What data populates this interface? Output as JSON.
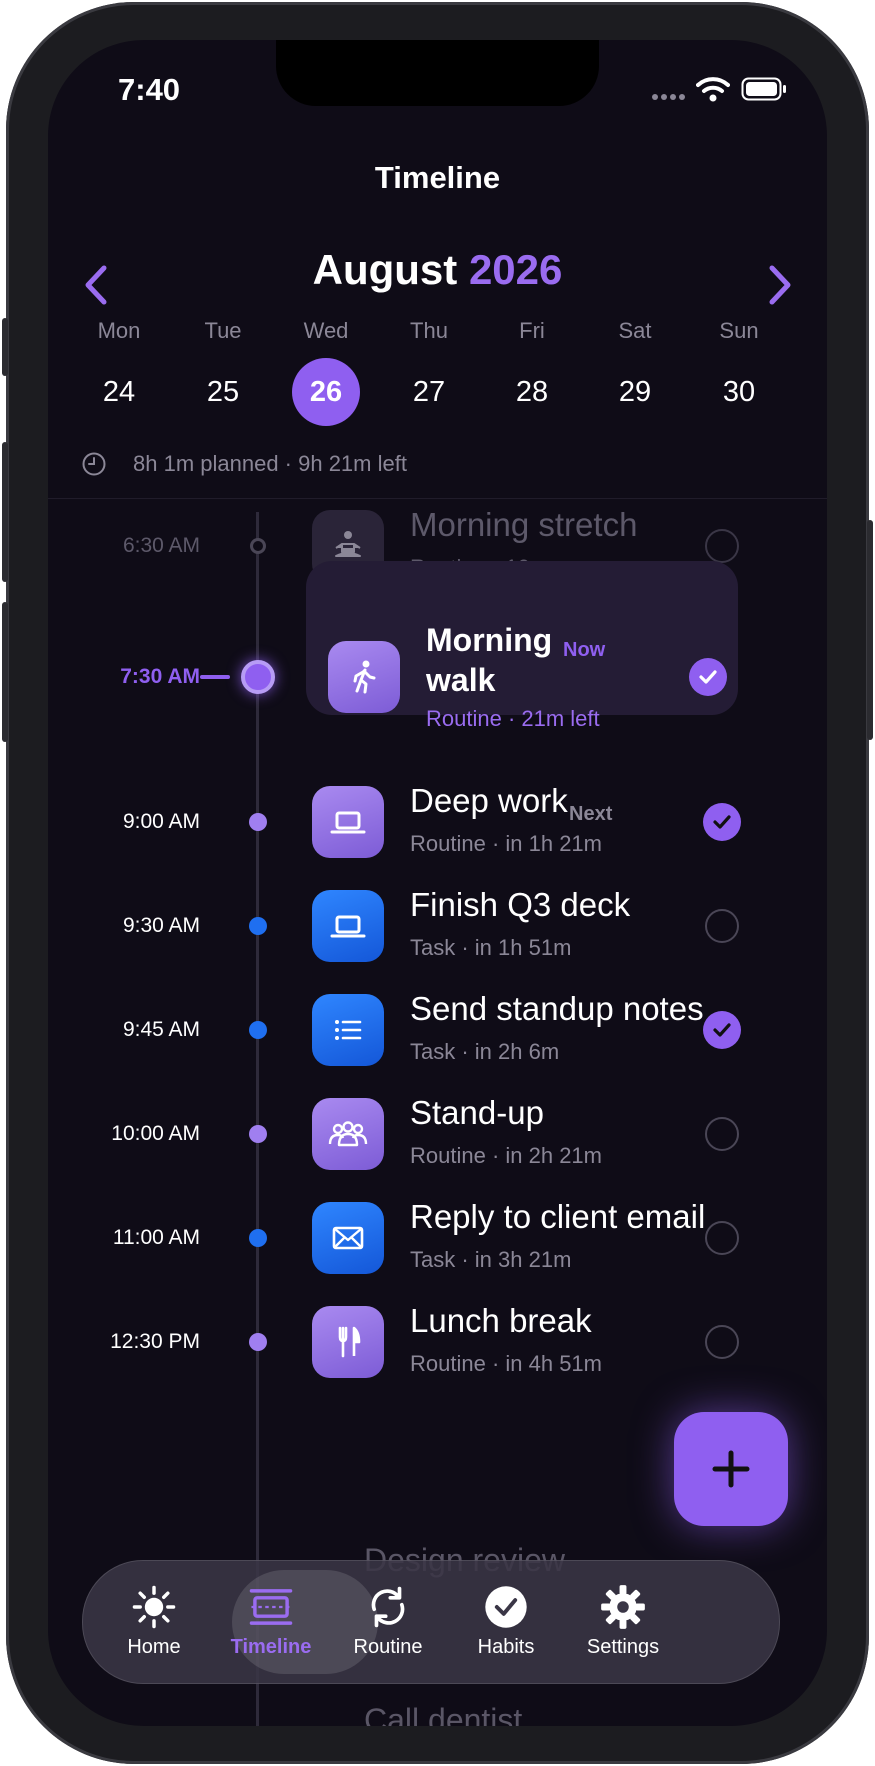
{
  "status_bar": {
    "time": "7:40"
  },
  "header": {
    "title": "Timeline"
  },
  "calendar": {
    "month": "August",
    "year": "2026",
    "days": [
      {
        "name": "Mon",
        "num": "24"
      },
      {
        "name": "Tue",
        "num": "25"
      },
      {
        "name": "Wed",
        "num": "26",
        "selected": true
      },
      {
        "name": "Thu",
        "num": "27"
      },
      {
        "name": "Fri",
        "num": "28"
      },
      {
        "name": "Sat",
        "num": "29"
      },
      {
        "name": "Sun",
        "num": "30"
      }
    ],
    "summary": "8h 1m planned · 9h 21m left"
  },
  "timeline": {
    "items": [
      {
        "time": "6:30 AM",
        "title": "Morning stretch",
        "subtitle": "Routine · 10m",
        "icon": "meditation-icon",
        "kind": "routine",
        "done": false,
        "state": "past"
      },
      {
        "time": "7:30 AM",
        "title": "Morning walk",
        "tag": "Now",
        "subtitle": "Routine · 21m left",
        "icon": "walking-icon",
        "kind": "routine",
        "done": true,
        "state": "current"
      },
      {
        "time": "9:00 AM",
        "title": "Deep work",
        "tag": "Next",
        "subtitle": "Routine · in 1h 21m",
        "icon": "laptop-icon",
        "kind": "routine",
        "done": true
      },
      {
        "time": "9:30 AM",
        "title": "Finish Q3 deck",
        "subtitle": "Task · in 1h 51m",
        "icon": "laptop-icon",
        "kind": "task",
        "done": false
      },
      {
        "time": "9:45 AM",
        "title": "Send standup notes",
        "subtitle": "Task · in 2h 6m",
        "icon": "list-icon",
        "kind": "task",
        "done": true
      },
      {
        "time": "10:00 AM",
        "title": "Stand-up",
        "subtitle": "Routine · in 2h 21m",
        "icon": "group-icon",
        "kind": "routine",
        "done": false
      },
      {
        "time": "11:00 AM",
        "title": "Reply to client email",
        "subtitle": "Task · in 3h 21m",
        "icon": "envelope-icon",
        "kind": "task",
        "done": false
      },
      {
        "time": "12:30 PM",
        "title": "Lunch break",
        "subtitle": "Routine · in 4h 51m",
        "icon": "fork-knife-icon",
        "kind": "routine",
        "done": false
      }
    ]
  },
  "tabbar": {
    "tabs": [
      {
        "label": "Home",
        "icon": "sun-icon"
      },
      {
        "label": "Timeline",
        "icon": "timeline-icon",
        "active": true
      },
      {
        "label": "Routine",
        "icon": "repeat-icon"
      },
      {
        "label": "Habits",
        "icon": "checkmark-circle-icon"
      },
      {
        "label": "Settings",
        "icon": "gear-icon"
      }
    ]
  },
  "colors": {
    "accent": "#8f5ff0",
    "task_blue": "#1f6ff0",
    "background": "#0f0c17"
  }
}
